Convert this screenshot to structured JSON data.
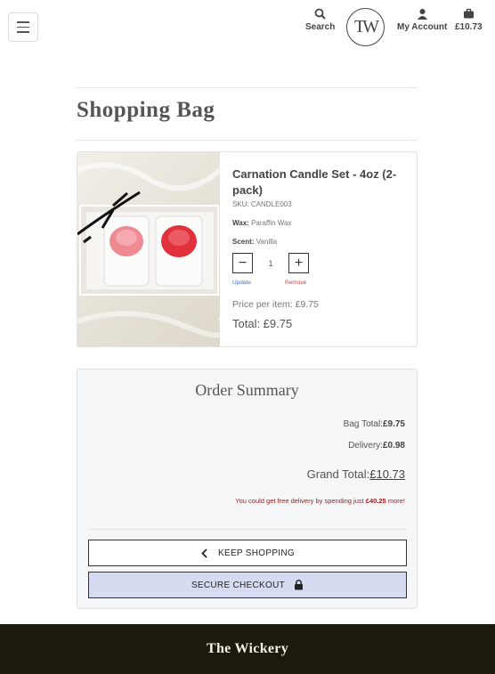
{
  "header": {
    "search_label": "Search",
    "logo_text": "TW",
    "account_label": "My Account",
    "bag_total": "£10.73"
  },
  "page": {
    "title": "Shopping Bag"
  },
  "item": {
    "name": "Carnation Candle Set - 4oz (2-pack)",
    "sku": "SKU: CANDLE003",
    "wax_label": "Wax:",
    "wax_value": "Paraffin Wax",
    "scent_label": "Scent:",
    "scent_value": "Vanilla",
    "quantity": "1",
    "update_label": "Update",
    "remove_label": "Remove",
    "price_per_item": "Price per item: £9.75",
    "total": "Total: £9.75"
  },
  "summary": {
    "title": "Order Summary",
    "bag_total_label": "Bag Total:",
    "bag_total_value": "£9.75",
    "delivery_label": "Delivery:",
    "delivery_value": "£0.98",
    "grand_total_label": "Grand Total:",
    "grand_total_value": "£10.73",
    "note_prefix": "You could get free delivery by spending just ",
    "note_amount": "£40.25",
    "note_suffix": " more!",
    "keep_shopping_label": "KEEP SHOPPING",
    "checkout_label": "SECURE CHECKOUT"
  },
  "footer": {
    "brand": "The Wickery"
  },
  "colors": {
    "footer_bg": "#1b1a0c",
    "checkout_bg": "#d6dbf2",
    "note_red": "#a02020",
    "link_blue": "#3f6fd0",
    "remove_red": "#d04040"
  }
}
